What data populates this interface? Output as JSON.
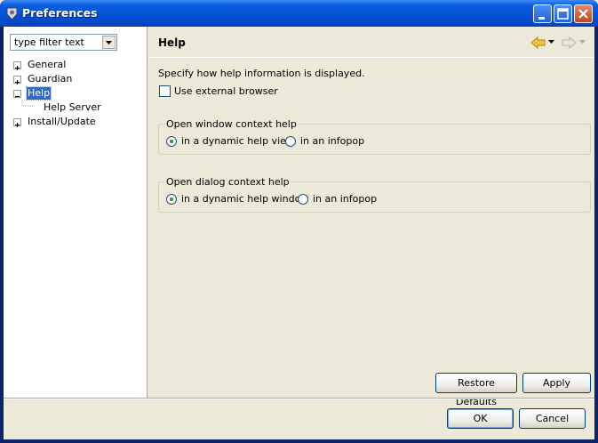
{
  "window": {
    "title": "Preferences"
  },
  "filter": {
    "value": "type filter text"
  },
  "tree": {
    "items": [
      {
        "label": "General",
        "expander": "+"
      },
      {
        "label": "Guardian",
        "expander": "+"
      },
      {
        "label": "Help",
        "expander": "-",
        "selected": true
      },
      {
        "label": "Help Server"
      },
      {
        "label": "Install/Update",
        "expander": "+"
      }
    ]
  },
  "page": {
    "title": "Help",
    "description": "Specify how help information is displayed.",
    "external_browser_label": "Use external browser",
    "window_group": {
      "legend": "Open window context help",
      "option1": "in a dynamic help view",
      "option2": "in an infopop",
      "selected": "option1"
    },
    "dialog_group": {
      "legend": "Open dialog context help",
      "option1": "in a dynamic help window",
      "option2": "in an infopop",
      "selected": "option1"
    },
    "restore_defaults": "Restore Defaults",
    "apply": "Apply"
  },
  "dialog": {
    "ok": "OK",
    "cancel": "Cancel"
  },
  "colors": {
    "titlebar": "#0453d8",
    "selection": "#316ac5",
    "nav_arrow": "#e8a317"
  },
  "icons": {
    "back": "back-arrow-icon",
    "forward": "forward-arrow-icon"
  }
}
